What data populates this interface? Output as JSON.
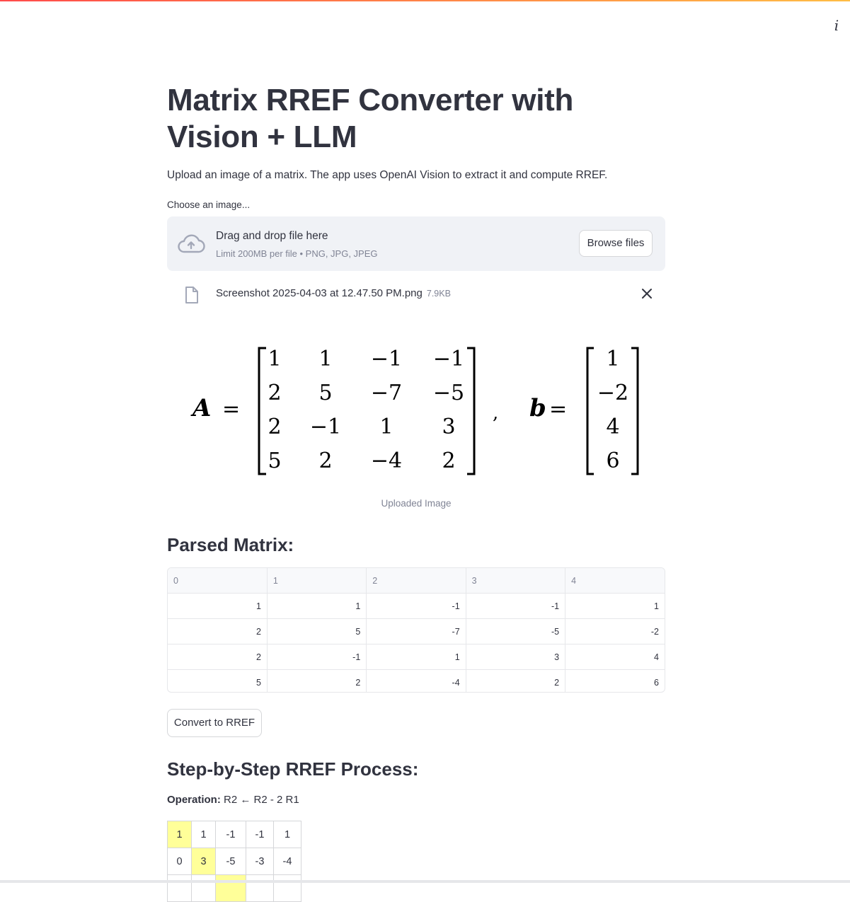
{
  "header": {
    "info_icon": "info-icon"
  },
  "page": {
    "title": "Matrix RREF Converter with Vision + LLM",
    "subtitle": "Upload an image of a matrix. The app uses OpenAI Vision to extract it and compute RREF."
  },
  "uploader": {
    "label": "Choose an image...",
    "drop_text": "Drag and drop file here",
    "limit_text": "Limit 200MB per file • PNG, JPG, JPEG",
    "browse_label": "Browse files",
    "file_name": "Screenshot 2025-04-03 at 12.47.50 PM.png",
    "file_size": "7.9KB"
  },
  "image": {
    "caption": "Uploaded Image",
    "A_label": "A",
    "b_label": "b",
    "A": [
      [
        "1",
        "1",
        "−1",
        "−1"
      ],
      [
        "2",
        "5",
        "−7",
        "−5"
      ],
      [
        "2",
        "−1",
        "1",
        "3"
      ],
      [
        "5",
        "2",
        "−4",
        "2"
      ]
    ],
    "b": [
      "1",
      "−2",
      "4",
      "6"
    ]
  },
  "parsed": {
    "heading": "Parsed Matrix:",
    "columns": [
      "0",
      "1",
      "2",
      "3",
      "4"
    ],
    "rows": [
      [
        "1",
        "1",
        "-1",
        "-1",
        "1"
      ],
      [
        "2",
        "5",
        "-7",
        "-5",
        "-2"
      ],
      [
        "2",
        "-1",
        "1",
        "3",
        "4"
      ],
      [
        "5",
        "2",
        "-4",
        "2",
        "6"
      ]
    ]
  },
  "convert_label": "Convert to RREF",
  "steps": {
    "heading": "Step-by-Step RREF Process:",
    "operation_label": "Operation:",
    "operation": "R2 ← R2 - 2 R1",
    "rows": [
      [
        "1",
        "1",
        "-1",
        "-1",
        "1"
      ],
      [
        "0",
        "3",
        "-5",
        "-3",
        "-4"
      ]
    ]
  },
  "colors": {
    "accent_red": "#ff4b4b",
    "highlight": "#ffff99",
    "text": "#31333f",
    "muted": "#808495"
  }
}
